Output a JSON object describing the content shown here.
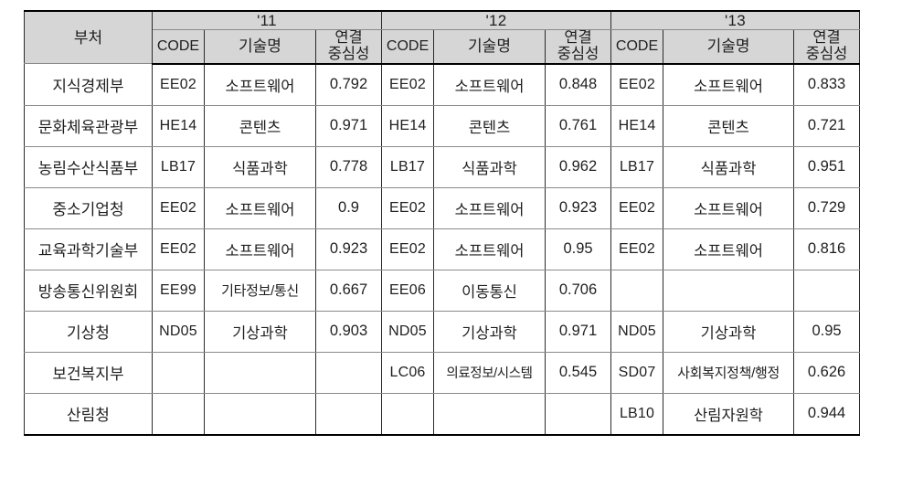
{
  "table": {
    "header": {
      "dept_label": "부처",
      "year_groups": [
        "'11",
        "'12",
        "'13"
      ],
      "sub_headers": {
        "code": "CODE",
        "tech": "기술명",
        "centrality_line1": "연결",
        "centrality_line2": "중심성"
      }
    },
    "rows": [
      {
        "dept": "지식경제부",
        "y11": {
          "code": "EE02",
          "tech": "소프트웨어",
          "cent": "0.792"
        },
        "y12": {
          "code": "EE02",
          "tech": "소프트웨어",
          "cent": "0.848"
        },
        "y13": {
          "code": "EE02",
          "tech": "소프트웨어",
          "cent": "0.833"
        }
      },
      {
        "dept": "문화체육관광부",
        "y11": {
          "code": "HE14",
          "tech": "콘텐츠",
          "cent": "0.971"
        },
        "y12": {
          "code": "HE14",
          "tech": "콘텐츠",
          "cent": "0.761"
        },
        "y13": {
          "code": "HE14",
          "tech": "콘텐츠",
          "cent": "0.721"
        }
      },
      {
        "dept": "농림수산식품부",
        "y11": {
          "code": "LB17",
          "tech": "식품과학",
          "cent": "0.778"
        },
        "y12": {
          "code": "LB17",
          "tech": "식품과학",
          "cent": "0.962"
        },
        "y13": {
          "code": "LB17",
          "tech": "식품과학",
          "cent": "0.951"
        }
      },
      {
        "dept": "중소기업청",
        "y11": {
          "code": "EE02",
          "tech": "소프트웨어",
          "cent": "0.9"
        },
        "y12": {
          "code": "EE02",
          "tech": "소프트웨어",
          "cent": "0.923"
        },
        "y13": {
          "code": "EE02",
          "tech": "소프트웨어",
          "cent": "0.729"
        }
      },
      {
        "dept": "교육과학기술부",
        "y11": {
          "code": "EE02",
          "tech": "소프트웨어",
          "cent": "0.923"
        },
        "y12": {
          "code": "EE02",
          "tech": "소프트웨어",
          "cent": "0.95"
        },
        "y13": {
          "code": "EE02",
          "tech": "소프트웨어",
          "cent": "0.816"
        }
      },
      {
        "dept": "방송통신위원회",
        "y11": {
          "code": "EE99",
          "tech": "기타정보/통신",
          "cent": "0.667"
        },
        "y12": {
          "code": "EE06",
          "tech": "이동통신",
          "cent": "0.706"
        },
        "y13": {
          "code": "",
          "tech": "",
          "cent": ""
        }
      },
      {
        "dept": "기상청",
        "y11": {
          "code": "ND05",
          "tech": "기상과학",
          "cent": "0.903"
        },
        "y12": {
          "code": "ND05",
          "tech": "기상과학",
          "cent": "0.971"
        },
        "y13": {
          "code": "ND05",
          "tech": "기상과학",
          "cent": "0.95"
        }
      },
      {
        "dept": "보건복지부",
        "y11": {
          "code": "",
          "tech": "",
          "cent": ""
        },
        "y12": {
          "code": "LC06",
          "tech": "의료정보/시스템",
          "cent": "0.545"
        },
        "y13": {
          "code": "SD07",
          "tech": "사회복지정책/행정",
          "cent": "0.626"
        }
      },
      {
        "dept": "산림청",
        "y11": {
          "code": "",
          "tech": "",
          "cent": ""
        },
        "y12": {
          "code": "",
          "tech": "",
          "cent": ""
        },
        "y13": {
          "code": "LB10",
          "tech": "산림자원학",
          "cent": "0.944"
        }
      }
    ]
  },
  "colors": {
    "header_background": "#d6d6d6",
    "border": "#2b2b2b",
    "text": "#1f1f1f",
    "page_background": "#ffffff"
  }
}
